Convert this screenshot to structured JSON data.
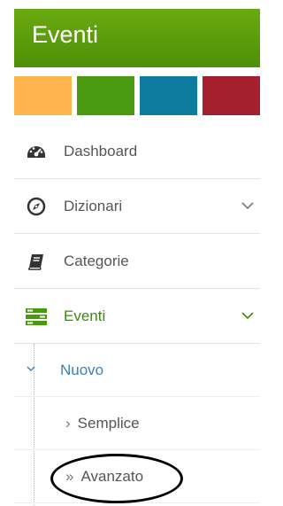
{
  "header": {
    "title": "Eventi"
  },
  "colors": {
    "header_green": "#5a9c0c",
    "swatches": [
      "#ffb54d",
      "#4a9a0f",
      "#0e7c9e",
      "#a5202e"
    ]
  },
  "menu": {
    "items": [
      {
        "label": "Dashboard",
        "icon": "dashboard-icon",
        "chevron": false
      },
      {
        "label": "Dizionari",
        "icon": "compass-icon",
        "chevron": true
      },
      {
        "label": "Categorie",
        "icon": "book-icon",
        "chevron": false
      },
      {
        "label": "Eventi",
        "icon": "list-icon",
        "chevron": true,
        "active": true
      }
    ],
    "submenu": {
      "label": "Nuovo",
      "children": [
        {
          "label": "Semplice",
          "marker": "›"
        },
        {
          "label": "Avanzato",
          "marker": "»"
        }
      ]
    }
  }
}
